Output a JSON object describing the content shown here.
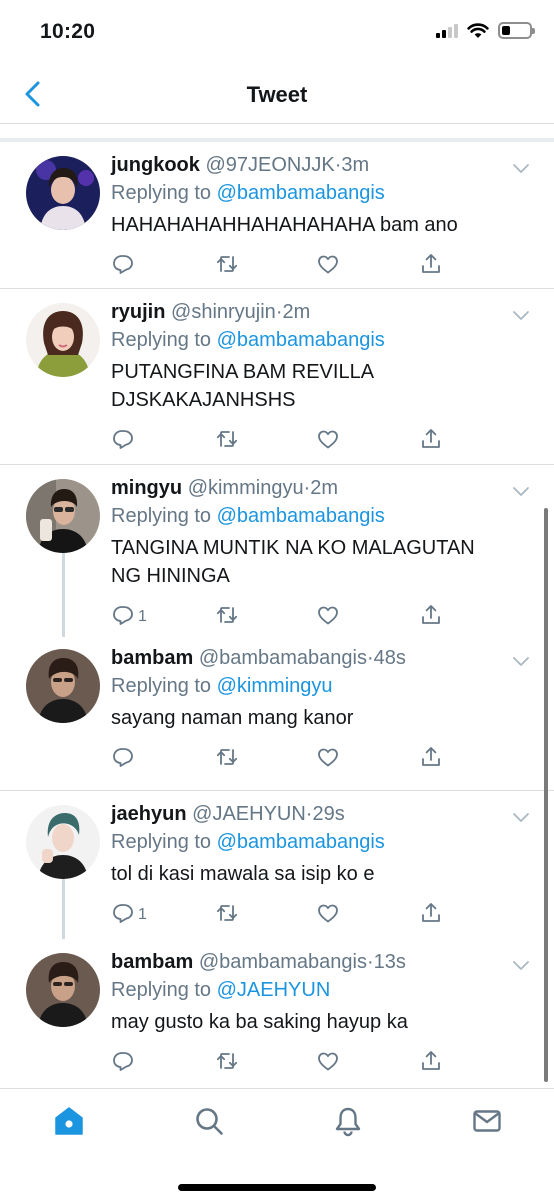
{
  "status_bar": {
    "time": "10:20"
  },
  "nav": {
    "title": "Tweet"
  },
  "colors": {
    "accent": "#1b95e0",
    "secondary_text": "#657786",
    "separator": "#e6ecf0"
  },
  "tweets": [
    {
      "name": "jungkook",
      "handle": "@97JEONJJK",
      "dot": "·",
      "time": "3m",
      "replying_prefix": "Replying to",
      "replying_to": "@bambamabangis",
      "text": [
        "HAHAHAHAHHAHAHAHAHA bam ano"
      ],
      "reply_count": "",
      "avatar": "avatar-jungkook"
    },
    {
      "name": "ryujin",
      "handle": "@shinryujin",
      "dot": "·",
      "time": "2m",
      "replying_prefix": "Replying to",
      "replying_to": "@bambamabangis",
      "text": [
        "PUTANGFINA BAM REVILLA",
        "DJSKAKAJANHSHS"
      ],
      "reply_count": "",
      "avatar": "avatar-ryujin"
    },
    {
      "name": "mingyu",
      "handle": "@kimmingyu",
      "dot": "·",
      "time": "2m",
      "replying_prefix": "Replying to",
      "replying_to": "@bambamabangis",
      "text": [
        "TANGINA MUNTIK NA KO MALAGUTAN",
        "NG HININGA"
      ],
      "reply_count": "1",
      "avatar": "avatar-mingyu"
    },
    {
      "name": "bambam",
      "handle": "@bambamabangis",
      "dot": "·",
      "time": "48s",
      "replying_prefix": "Replying to",
      "replying_to": "@kimmingyu",
      "text": [
        "sayang naman mang kanor"
      ],
      "reply_count": "",
      "avatar": "avatar-bambam"
    },
    {
      "name": "jaehyun",
      "handle": "@JAEHYUN",
      "dot": "·",
      "time": "29s",
      "replying_prefix": "Replying to",
      "replying_to": "@bambamabangis",
      "text": [
        "tol di kasi mawala sa isip ko e"
      ],
      "reply_count": "1",
      "avatar": "avatar-jaehyun"
    },
    {
      "name": "bambam",
      "handle": "@bambamabangis",
      "dot": "·",
      "time": "13s",
      "replying_prefix": "Replying to",
      "replying_to": "@JAEHYUN",
      "text": [
        "may gusto ka ba saking hayup ka"
      ],
      "reply_count": "",
      "avatar": "avatar-bambam"
    }
  ],
  "tab_bar": {
    "active": "home",
    "tabs": [
      "home",
      "search",
      "notifications",
      "messages"
    ]
  }
}
